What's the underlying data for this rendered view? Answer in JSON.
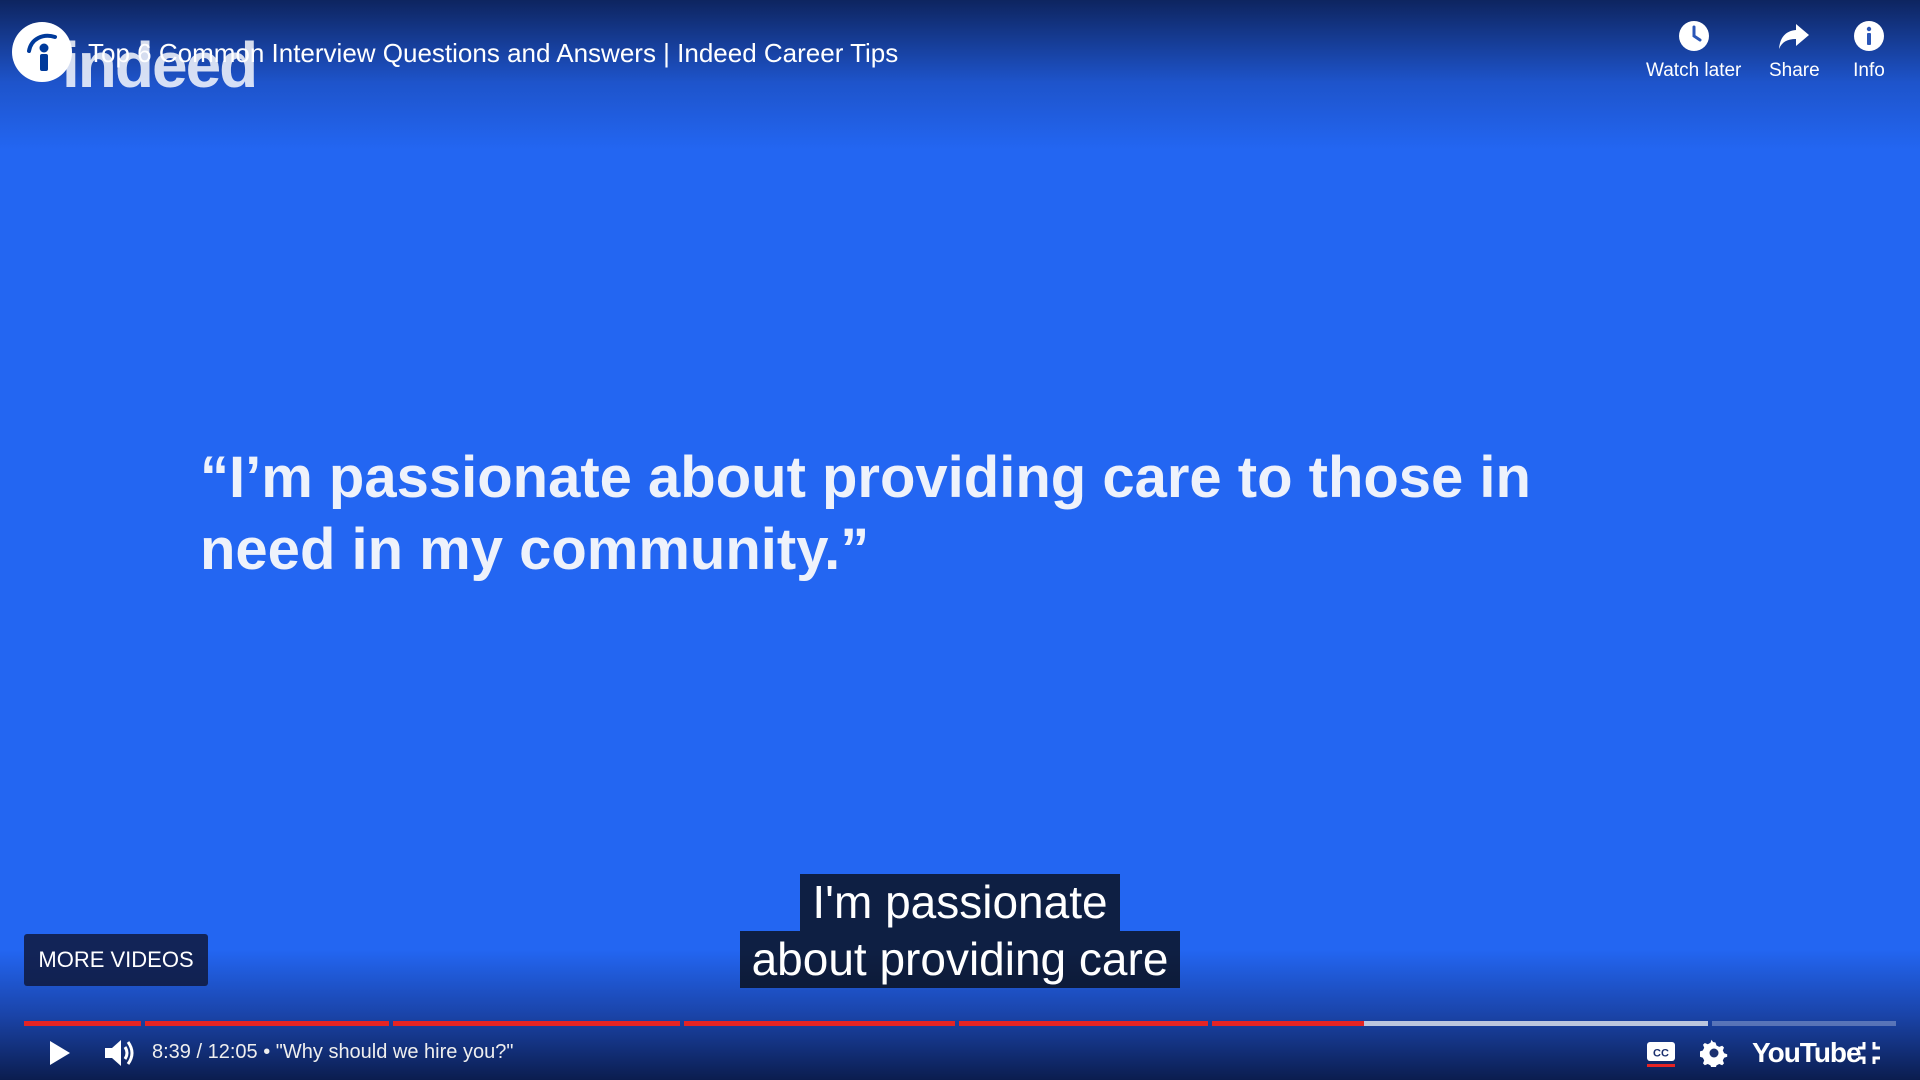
{
  "video": {
    "title": "Top 6 Common Interview Questions and Answers | Indeed Career Tips",
    "watermark": "indeed",
    "on_screen_quote_line1": "“I’m passionate about providing care to those in",
    "on_screen_quote_line2": "need in my community.”"
  },
  "top_actions": [
    {
      "label": "Watch later",
      "icon": "clock-icon"
    },
    {
      "label": "Share",
      "icon": "share-arrow-icon"
    },
    {
      "label": "Info",
      "icon": "info-icon"
    }
  ],
  "captions": {
    "line1": "I'm passionate",
    "line2": "about providing care"
  },
  "more_videos_label": "MORE VIDEOS",
  "controls": {
    "time_current": "8:39",
    "time_total": "12:05",
    "time_display": "8:39 / 12:05",
    "chapter_separator": " • ",
    "chapter_title": "\"Why should we hire you?\"",
    "brand": "YouTube",
    "icons": [
      "play-icon",
      "volume-icon",
      "captions-icon",
      "settings-gear-icon",
      "exit-fullscreen-icon"
    ]
  },
  "playback": {
    "played_fraction": 0.716,
    "loaded_fraction": 0.9
  },
  "colors": {
    "background": "#2366f2",
    "progress_played": "#e52424",
    "captions_underline": "#e52424"
  }
}
